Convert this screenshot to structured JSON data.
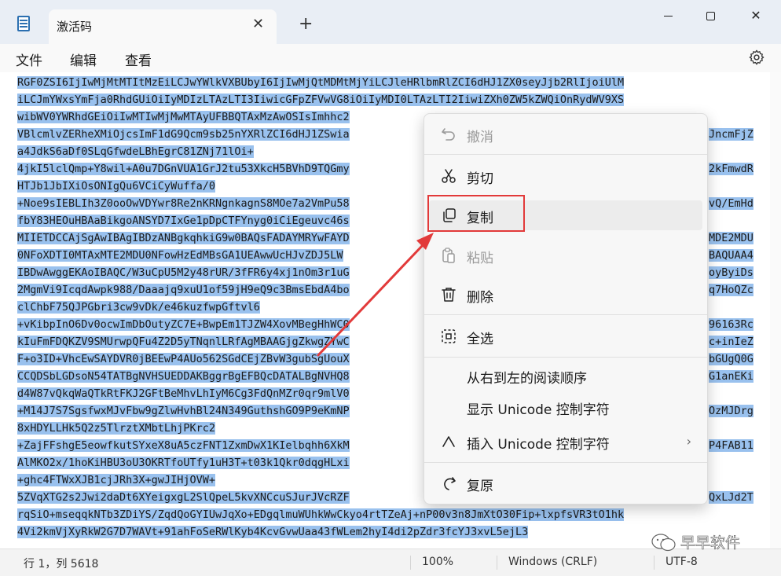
{
  "window": {
    "tab_title": "激活码",
    "tab_close": "✕",
    "new_tab": "+",
    "close_glyph": "✕"
  },
  "menu": {
    "file": "文件",
    "edit": "编辑",
    "view": "查看"
  },
  "editor": {
    "lines": [
      "RGF0ZSI6IjIwMjMtMTItMzEiLCJwYWlkVXBUbyI6IjIwMjQtMDMtMjYiLCJleHRlbmRlZCI6dHJ1ZX0seyJjb2RlIjoiUlM",
      "iLCJmYWxsYmFja0RhdGUiOiIyMDIzLTAzLTI3IiwicGFpZFVwVG8iOiIyMDI0LTAzLTI2IiwiZXh0ZW5kZWQiOnRydWV9XS",
      "wibWV0YWRhdGEiOiIwMTIwMjMwMTAyUFBBQTAxMzAwOSIsImhhc2",
      "VBlcmlvZERheXMiOjcsImF1dG9Qcm9sb25nYXRlZCI6dHJ1ZSwia",
      "a4JdkS6aDf0SLqGfwdeLBhEgrC81ZNj71lOi+",
      "4jkI5lclQmp+Y8wil+A0u7DGnVUA1GrJ2tu53XkcH5BVhD9TQGmy",
      "HTJb1JbIXiOsONIgQu6VCiCyWuffa/0",
      "+Noe9sIEBLIh3Z0ooOwVDYwr8Re2nKRNgnkagnS8MOe7a2VmPu58",
      "fbY83HEOuHBAaBikgoANSYD7IxGe1pDpCTFYnyg0iCiEgeuvc46s",
      "MIIETDCCAjSgAwIBAgIBDzANBgkqhkiG9w0BAQsFADAYMRYwFAYD",
      "0NFoXDTI0MTAxMTE2MDU0NFowHzEdMBsGA1UEAwwUcHJvZDJ5LW",
      "IBDwAwggEKAoIBAQC/W3uCpU5M2y48rUR/3fFR6y4xj1nOm3r1uG",
      "2MgmVi9IcqdAwpk988/Daaajq9xuU1of59jH9eQ9c3BmsEbdA4bo",
      "clChbF75QJPGbri3cw9vDk/e46kuzfwpGftvl6",
      "+vKibpInO6Dv0ocwImDbOutyZC7E+BwpEm1TJZW4XovMBegHhWC0",
      "kIuFmFDQKZV9SMUrwpQFu4Z2D5yTNqnlLRfAgMBAAGjgZkwgZYwC",
      "F+o3ID+VhcEwSAYDVR0jBEEwP4AUo562SGdCEjZBvW3gubSgUouX",
      "CCQDSbLGDsoN54TATBgNVHSUEDDAKBggrBgEFBQcDATALBgNVHQ8",
      "d4W87vQkqWaQTkRtFKJ2GFtBeMhvLhIyM6Cg3FdQnMZr0qr9mlV0",
      "+M14J7S7SgsfwxMJvFbw9gZlwHvhBl24N349GuthshGO9P9eKmNP",
      "8xHDYLLHk5Q2z5TlrztXMbtLhjPKrc2",
      "+ZajFFshgE5eowfkutSYxeX8uA5czFNT1ZxmDwX1KIelbqhh6XkM",
      "AlMKO2x/1hoKiHBU3oU3OKRTfoUTfy1uH3T+t03k1Qkr0dqgHLxi",
      "+ghc4FTWxXJB1cjJRh3X+gwJIHjOVW+",
      "5ZVqXTG2s2Jwi2daDt6XYeigxgL2SlQpeL5kvXNCcuSJurJVcRZF",
      "rqSiO+mseqqkNTb3ZDiYS/ZqdQoGYIUwJqXo+EDgqlmuWUhkWwCkyo4rtTZeAj+nP00v3n8JmXtO30Fip+lxpfsVR3tO1hk",
      "4Vi2kmVjXyRkW2G7D7WAVt+91ahFoSeRWlKyb4KcvGvwUaa43fWLem2hyI4di2pZdr3fcYJ3xvL5ejL3"
    ],
    "right_fragments": [
      "",
      "",
      "",
      "JncmFjZ",
      "",
      "2kFmwdR",
      "",
      "vQ/EmHd",
      "",
      "MDE2MDU",
      "BAQUAA4",
      "oyByiDs",
      "q7HoQZc",
      "",
      "96163Rc",
      "c+inIeZ",
      "bGUgQ0G",
      "G1anEKi",
      "",
      "OzMJDrg",
      "",
      "P4FAB11",
      "",
      "",
      "QxLJd2T",
      "",
      ""
    ]
  },
  "status": {
    "position": "行 1，列 5618",
    "zoom": "100%",
    "line_ending": "Windows (CRLF)",
    "encoding": "UTF-8"
  },
  "context_menu": {
    "undo": "撤消",
    "cut": "剪切",
    "copy": "复制",
    "paste": "粘贴",
    "delete": "删除",
    "select_all": "全选",
    "rtl": "从右到左的阅读顺序",
    "show_unicode": "显示 Unicode 控制字符",
    "insert_unicode": "插入 Unicode 控制字符",
    "reconvert": "复原",
    "submenu_arrow": "›"
  },
  "watermark": {
    "text": "早早软件"
  },
  "colors": {
    "selection": "#99c1ee",
    "highlight_box": "#e23a3a",
    "arrow": "#e23a3a"
  }
}
